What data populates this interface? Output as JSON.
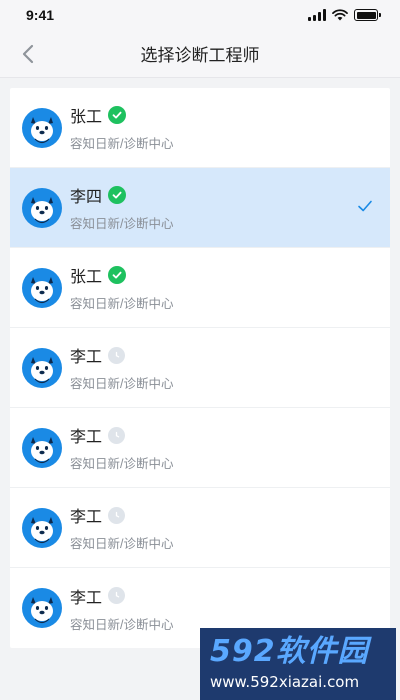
{
  "status": {
    "time": "9:41"
  },
  "nav": {
    "title": "选择诊断工程师"
  },
  "engineers": [
    {
      "name": "张工",
      "dept": "容知日新/诊断中心",
      "status": "verified",
      "selected": false
    },
    {
      "name": "李四",
      "dept": "容知日新/诊断中心",
      "status": "verified",
      "selected": true
    },
    {
      "name": "张工",
      "dept": "容知日新/诊断中心",
      "status": "verified",
      "selected": false
    },
    {
      "name": "李工",
      "dept": "容知日新/诊断中心",
      "status": "pending",
      "selected": false
    },
    {
      "name": "李工",
      "dept": "容知日新/诊断中心",
      "status": "pending",
      "selected": false
    },
    {
      "name": "李工",
      "dept": "容知日新/诊断中心",
      "status": "pending",
      "selected": false
    },
    {
      "name": "李工",
      "dept": "容知日新/诊断中心",
      "status": "pending",
      "selected": false
    }
  ],
  "watermark": {
    "title": "592软件园",
    "url": "www.592xiazai.com"
  },
  "colors": {
    "selected_bg": "#d6e8fb",
    "verified": "#1ec15f",
    "pending": "#dfe4ea",
    "avatar": "#1a8ae5",
    "check": "#1a8ae5"
  }
}
